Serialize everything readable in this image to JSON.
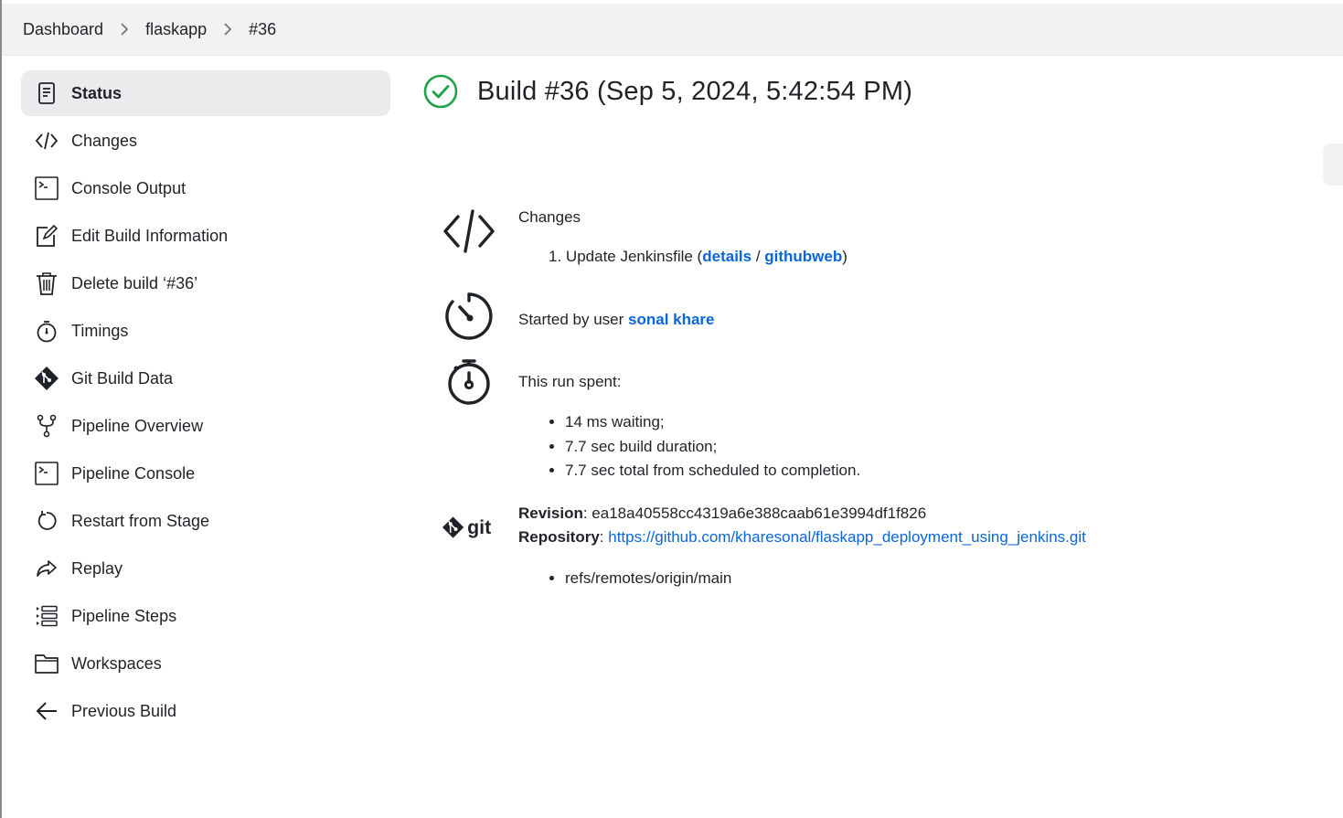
{
  "breadcrumb": [
    "Dashboard",
    "flaskapp",
    "#36"
  ],
  "sidebar": {
    "items": [
      {
        "label": "Status",
        "icon": "document-icon"
      },
      {
        "label": "Changes",
        "icon": "code-icon"
      },
      {
        "label": "Console Output",
        "icon": "terminal-icon"
      },
      {
        "label": "Edit Build Information",
        "icon": "edit-icon"
      },
      {
        "label": "Delete build ‘#36’",
        "icon": "trash-icon"
      },
      {
        "label": "Timings",
        "icon": "stopwatch-icon"
      },
      {
        "label": "Git Build Data",
        "icon": "git-icon"
      },
      {
        "label": "Pipeline Overview",
        "icon": "fork-icon"
      },
      {
        "label": "Pipeline Console",
        "icon": "terminal-icon"
      },
      {
        "label": "Restart from Stage",
        "icon": "restart-icon"
      },
      {
        "label": "Replay",
        "icon": "replay-icon"
      },
      {
        "label": "Pipeline Steps",
        "icon": "list-icon"
      },
      {
        "label": "Workspaces",
        "icon": "folder-icon"
      },
      {
        "label": "Previous Build",
        "icon": "arrow-left-icon"
      }
    ]
  },
  "build": {
    "title": "Build #36 (Sep 5, 2024, 5:42:54 PM)",
    "status_color": "#1ea446"
  },
  "changes": {
    "heading": "Changes",
    "item_number": "1.",
    "item_text": "Update Jenkinsfile (",
    "details_link": "details",
    "slash": " / ",
    "githubweb_link": "githubweb",
    "close_paren": ")"
  },
  "started": {
    "prefix": "Started by user ",
    "user": "sonal khare"
  },
  "timing": {
    "heading": "This run spent:",
    "items": [
      "14 ms waiting;",
      "7.7 sec build duration;",
      "7.7 sec total from scheduled to completion."
    ]
  },
  "git": {
    "icon_text": "git",
    "revision_label": "Revision",
    "revision_value": ": ea18a40558cc4319a6e388caab61e3994df1f826",
    "repository_label": "Repository",
    "repository_sep": ": ",
    "repository_url": "https://github.com/kharesonal/flaskapp_deployment_using_jenkins.git",
    "branches": [
      "refs/remotes/origin/main"
    ]
  },
  "colors": {
    "link": "#0a66d8",
    "active_bg": "#ebebee",
    "topbar_bg": "#f2f2f3"
  }
}
